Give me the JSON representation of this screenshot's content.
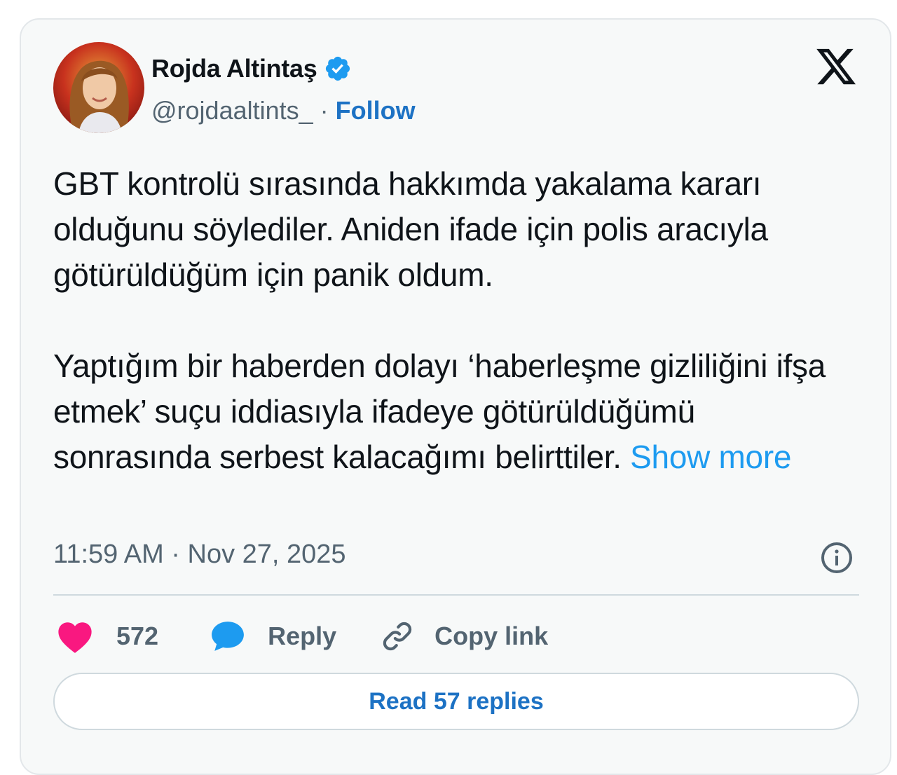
{
  "author": {
    "display_name": "Rojda Altintaş",
    "handle": "@rojdaaltints_",
    "separator": "·",
    "follow_label": "Follow",
    "verified": true
  },
  "brand_icon": "x-logo-icon",
  "tweet": {
    "paragraph_1": "GBT kontrolü sırasında hakkımda yakalama kararı olduğunu söylediler. Aniden ifade için polis aracıyla götürüldüğüm için panik oldum.",
    "paragraph_2": "Yaptığım bir haberden dolayı ‘haberleşme gizliliğini ifşa etmek’ suçu iddiasıyla ifadeye götürüldüğümü sonrasında serbest kalacağımı belirttiler.",
    "show_more_label": "Show more",
    "timestamp": "11:59 AM · Nov 27, 2025"
  },
  "actions": {
    "like_count": "572",
    "reply_label": "Reply",
    "copy_link_label": "Copy link"
  },
  "read_replies_label": "Read 57 replies",
  "colors": {
    "card_background": "#f7f9f9",
    "text_primary": "#0f1419",
    "text_secondary": "#536471",
    "link_blue": "#1d9bf0",
    "follow_blue": "#1d72c4",
    "like_pink": "#f91880",
    "reply_blue": "#1d9bf0",
    "verified_blue": "#1d9bf0"
  }
}
